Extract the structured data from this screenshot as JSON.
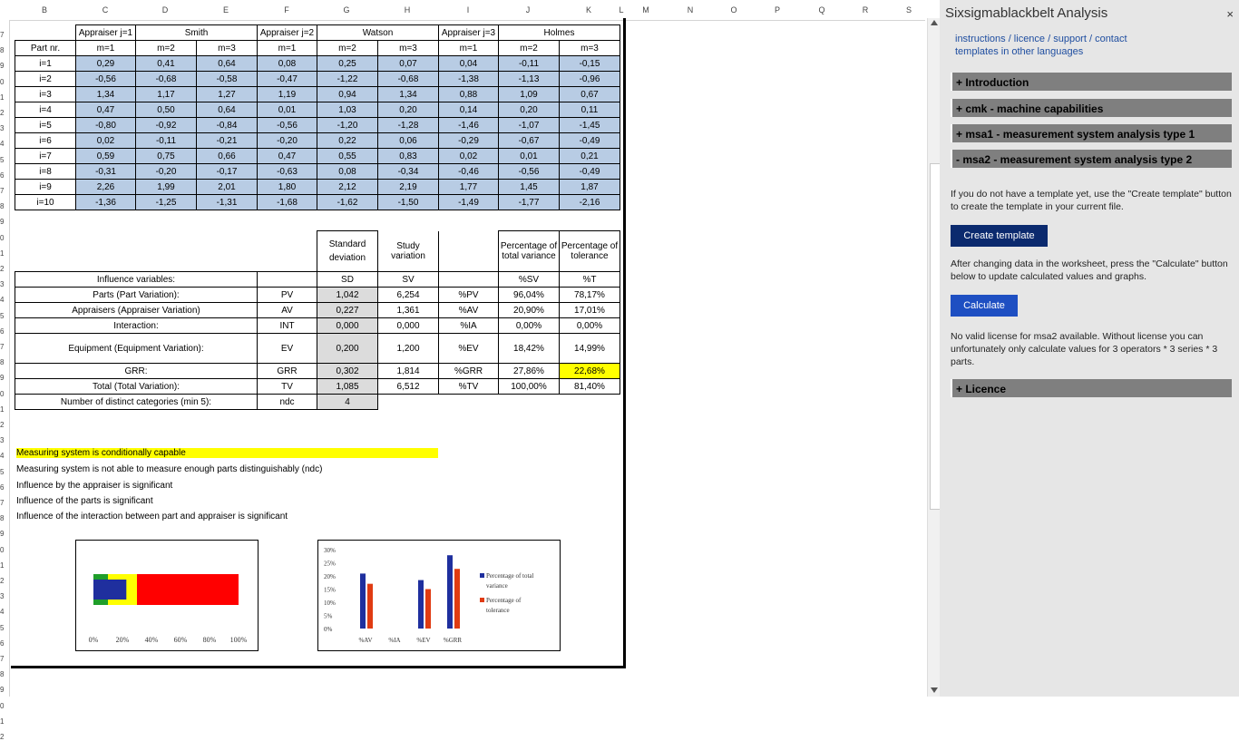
{
  "columns": [
    "B",
    "C",
    "D",
    "E",
    "F",
    "G",
    "H",
    "I",
    "J",
    "K",
    "L",
    "M",
    "N",
    "O",
    "P",
    "Q",
    "R",
    "S"
  ],
  "rows": [
    "7",
    "8",
    "9",
    "0",
    "1",
    "2",
    "3",
    "4",
    "5",
    "6",
    "7",
    "8",
    "9",
    "0",
    "1",
    "2",
    "3",
    "4",
    "5",
    "6",
    "7",
    "8",
    "9",
    "0",
    "1",
    "2",
    "3",
    "4",
    "5",
    "6",
    "7",
    "8",
    "9",
    "0",
    "1",
    "2",
    "3",
    "4",
    "5",
    "6",
    "7",
    "8",
    "9",
    "0",
    "1",
    "2"
  ],
  "appraisers": [
    {
      "label": "Appraiser j=1",
      "name": "Smith"
    },
    {
      "label": "Appraiser j=2",
      "name": "Watson"
    },
    {
      "label": "Appraiser j=3",
      "name": "Holmes"
    }
  ],
  "part_header": "Part nr.",
  "m_headers": [
    "m=1",
    "m=2",
    "m=3",
    "m=1",
    "m=2",
    "m=3",
    "m=1",
    "m=2",
    "m=3"
  ],
  "parts": [
    {
      "label": "i=1",
      "vals": [
        "0,29",
        "0,41",
        "0,64",
        "0,08",
        "0,25",
        "0,07",
        "0,04",
        "-0,11",
        "-0,15"
      ]
    },
    {
      "label": "i=2",
      "vals": [
        "-0,56",
        "-0,68",
        "-0,58",
        "-0,47",
        "-1,22",
        "-0,68",
        "-1,38",
        "-1,13",
        "-0,96"
      ]
    },
    {
      "label": "i=3",
      "vals": [
        "1,34",
        "1,17",
        "1,27",
        "1,19",
        "0,94",
        "1,34",
        "0,88",
        "1,09",
        "0,67"
      ]
    },
    {
      "label": "i=4",
      "vals": [
        "0,47",
        "0,50",
        "0,64",
        "0,01",
        "1,03",
        "0,20",
        "0,14",
        "0,20",
        "0,11"
      ]
    },
    {
      "label": "i=5",
      "vals": [
        "-0,80",
        "-0,92",
        "-0,84",
        "-0,56",
        "-1,20",
        "-1,28",
        "-1,46",
        "-1,07",
        "-1,45"
      ]
    },
    {
      "label": "i=6",
      "vals": [
        "0,02",
        "-0,11",
        "-0,21",
        "-0,20",
        "0,22",
        "0,06",
        "-0,29",
        "-0,67",
        "-0,49"
      ]
    },
    {
      "label": "i=7",
      "vals": [
        "0,59",
        "0,75",
        "0,66",
        "0,47",
        "0,55",
        "0,83",
        "0,02",
        "0,01",
        "0,21"
      ]
    },
    {
      "label": "i=8",
      "vals": [
        "-0,31",
        "-0,20",
        "-0,17",
        "-0,63",
        "0,08",
        "-0,34",
        "-0,46",
        "-0,56",
        "-0,49"
      ]
    },
    {
      "label": "i=9",
      "vals": [
        "2,26",
        "1,99",
        "2,01",
        "1,80",
        "2,12",
        "2,19",
        "1,77",
        "1,45",
        "1,87"
      ]
    },
    {
      "label": "i=10",
      "vals": [
        "-1,36",
        "-1,25",
        "-1,31",
        "-1,68",
        "-1,62",
        "-1,50",
        "-1,49",
        "-1,77",
        "-2,16"
      ]
    }
  ],
  "results": {
    "hdr": {
      "sd1": "Standard",
      "sd2": "deviation",
      "sv1": "Study",
      "sv2": "variation",
      "pct1a": "Percentage of",
      "pct1b": "total variance",
      "pct2a": "Percentage of",
      "pct2b": "tolerance"
    },
    "rows": [
      {
        "label": "Influence variables:",
        "abbr": "",
        "sd": "SD",
        "sv": "SV",
        "pabbr": "",
        "p1": "%SV",
        "p2": "%T"
      },
      {
        "label": "Parts (Part Variation):",
        "abbr": "PV",
        "sd": "1,042",
        "sv": "6,254",
        "pabbr": "%PV",
        "p1": "96,04%",
        "p2": "78,17%"
      },
      {
        "label": "Appraisers (Appraiser Variation)",
        "abbr": "AV",
        "sd": "0,227",
        "sv": "1,361",
        "pabbr": "%AV",
        "p1": "20,90%",
        "p2": "17,01%"
      },
      {
        "label": "Interaction:",
        "abbr": "INT",
        "sd": "0,000",
        "sv": "0,000",
        "pabbr": "%IA",
        "p1": "0,00%",
        "p2": "0,00%"
      },
      {
        "label": "Equipment (Equipment Variation):",
        "abbr": "EV",
        "sd": "0,200",
        "sv": "1,200",
        "pabbr": "%EV",
        "p1": "18,42%",
        "p2": "14,99%"
      },
      {
        "label": "GRR:",
        "abbr": "GRR",
        "sd": "0,302",
        "sv": "1,814",
        "pabbr": "%GRR",
        "p1": "27,86%",
        "p2": "22,68%"
      },
      {
        "label": "Total (Total Variation):",
        "abbr": "TV",
        "sd": "1,085",
        "sv": "6,512",
        "pabbr": "%TV",
        "p1": "100,00%",
        "p2": "81,40%"
      }
    ],
    "ndc": {
      "label": "Number of distinct categories (min 5):",
      "abbr": "ndc",
      "value": "4"
    }
  },
  "messages": [
    "Measuring system is conditionally capable",
    "Measuring system is not able to measure enough parts distinguishably (ndc)",
    "Influence by the appraiser is significant",
    "Influence of the parts is significant",
    "Influence of the interaction between part and appraiser is significant"
  ],
  "colors": {
    "highlight": "#ffff00",
    "input_blue": "#b8cce4",
    "calc_grey": "#dcdcdc",
    "series1": "#1f2f9e",
    "series2": "#e03b12",
    "green": "#1f9e2a",
    "red": "#ff0000"
  },
  "chart_data": [
    {
      "type": "bar",
      "title": "",
      "gauge_value_percent": 22.68,
      "bands": [
        {
          "color": "green",
          "to": 10
        },
        {
          "color": "yellow",
          "to": 30
        },
        {
          "color": "red",
          "to": 100
        }
      ],
      "x_ticks": [
        "0%",
        "20%",
        "40%",
        "60%",
        "80%",
        "100%"
      ],
      "xlim": [
        0,
        100
      ]
    },
    {
      "type": "bar",
      "title": "",
      "categories": [
        "%AV",
        "%IA",
        "%EV",
        "%GRR"
      ],
      "series": [
        {
          "name": "Percentage of total variance",
          "values": [
            20.9,
            0.0,
            18.42,
            27.86
          ]
        },
        {
          "name": "Percentage of tolerance",
          "values": [
            17.01,
            0.0,
            14.99,
            22.68
          ]
        }
      ],
      "y_ticks": [
        "0%",
        "5%",
        "10%",
        "15%",
        "20%",
        "25%",
        "30%"
      ],
      "ylim": [
        0,
        30
      ],
      "legend": "right"
    }
  ],
  "pane": {
    "title": "Sixsigmablackbelt Analysis",
    "close": "×",
    "link1": "instructions / licence / support / contact",
    "link2": "templates in other languages",
    "sections": [
      "+ Introduction",
      "+ cmk - machine capabilities",
      "+ msa1 - measurement system analysis type 1",
      "- msa2 - measurement system analysis type 2"
    ],
    "text1": "If you do not have a template yet, use the \"Create template\" button to create the template in your current file.",
    "btn_create": "Create template",
    "text2": "After changing data in the worksheet, press the \"Calculate\" button below to update calculated values and graphs.",
    "btn_calc": "Calculate",
    "text3": "No valid license for msa2 available. Without license you can unfortunately only calculate values for 3 operators * 3 series * 3 parts.",
    "licence": "+ Licence"
  }
}
